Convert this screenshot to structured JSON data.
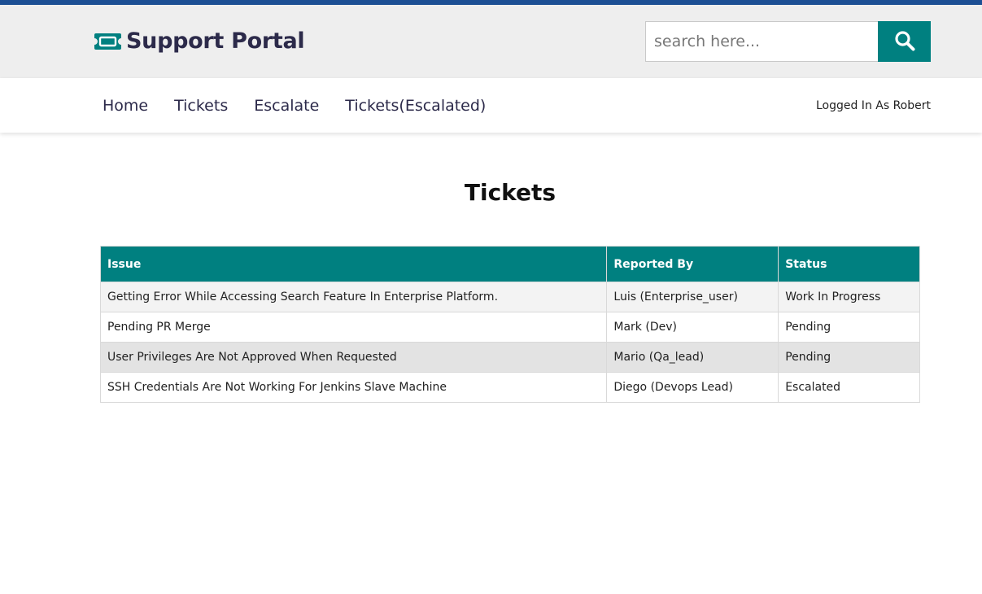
{
  "colors": {
    "top_strip": "#1c4f94",
    "accent": "#008080",
    "brand_text": "#2c2a4a",
    "header_bg": "#eeeeee"
  },
  "header": {
    "logo_icon": "ticket-icon",
    "title": "Support Portal",
    "search": {
      "placeholder": "search here...",
      "value": "",
      "button_icon": "search-icon"
    }
  },
  "nav": {
    "links": [
      "Home",
      "Tickets",
      "Escalate",
      "Tickets(Escalated)"
    ],
    "user_status": "Logged In As Robert"
  },
  "main": {
    "title": "Tickets",
    "table": {
      "columns": [
        "Issue",
        "Reported By",
        "Status"
      ],
      "rows": [
        [
          "Getting Error While Accessing Search Feature In Enterprise Platform.",
          "Luis (Enterprise_user)",
          "Work In Progress"
        ],
        [
          "Pending PR Merge",
          "Mark (Dev)",
          "Pending"
        ],
        [
          "User Privileges Are Not Approved When Requested",
          "Mario (Qa_lead)",
          "Pending"
        ],
        [
          "SSH Credentials Are Not Working For Jenkins Slave Machine",
          "Diego (Devops Lead)",
          "Escalated"
        ]
      ]
    }
  }
}
